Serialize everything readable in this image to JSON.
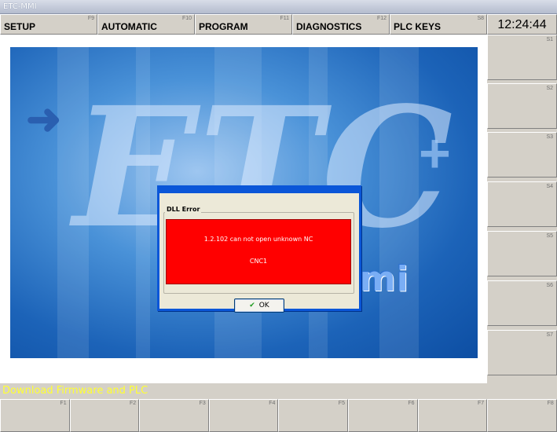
{
  "window": {
    "title": "ETC-MMI"
  },
  "menu": [
    {
      "label": "SETUP",
      "fkey": "F9"
    },
    {
      "label": "AUTOMATIC",
      "fkey": "F10"
    },
    {
      "label": "PROGRAM",
      "fkey": "F11"
    },
    {
      "label": "DIAGNOSTICS",
      "fkey": "F12"
    },
    {
      "label": "PLC KEYS",
      "fkey": "S8"
    }
  ],
  "clock": "12:24:44",
  "splash": {
    "logo_text": "ETC",
    "sub_text": "mmi"
  },
  "side_buttons": [
    "S1",
    "S2",
    "S3",
    "S4",
    "S5",
    "S6",
    "S7"
  ],
  "status_text": "Download Firmware and PLC",
  "bottom_buttons": [
    "F1",
    "F2",
    "F3",
    "F4",
    "F5",
    "F6",
    "F7",
    "F8"
  ],
  "dialog": {
    "group_label": "DLL Error",
    "message_line1": "1.2.102 can not open unknown NC",
    "message_line2": "CNC1",
    "ok_label": "OK"
  },
  "colors": {
    "status_text": "#ffff33",
    "error_bg": "#ff0000",
    "dialog_border": "#0a56d8"
  }
}
